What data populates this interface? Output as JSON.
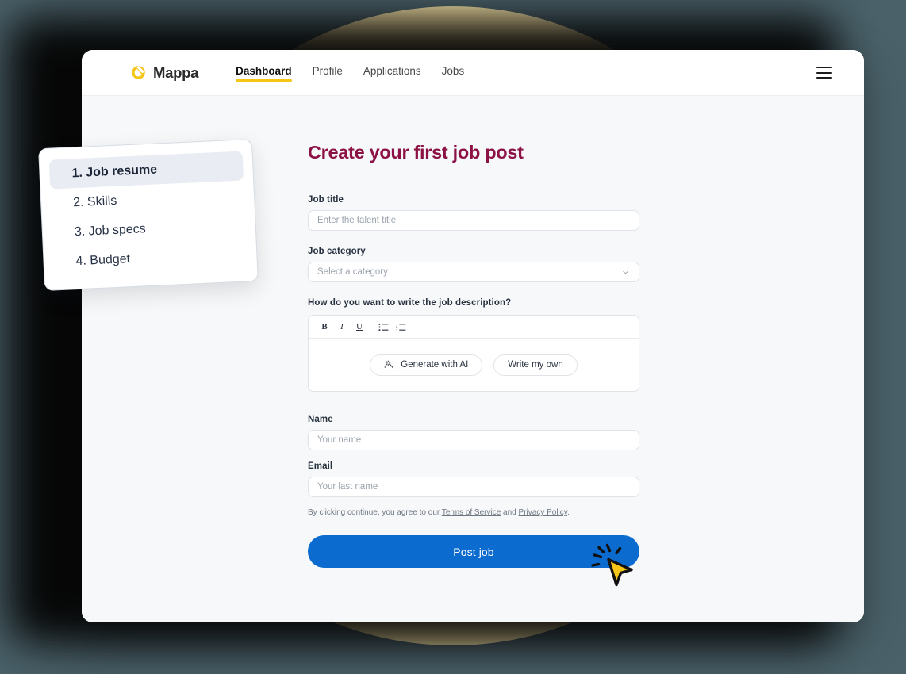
{
  "background": {
    "page_color": "#4a6169",
    "circle_color": "#f7e5a9"
  },
  "topbar": {
    "brand": {
      "logo_icon": "mappa-logo-icon",
      "name": "Mappa",
      "logo_color": "#f5c518"
    },
    "nav": [
      {
        "label": "Dashboard",
        "active": true
      },
      {
        "label": "Profile",
        "active": false
      },
      {
        "label": "Applications",
        "active": false
      },
      {
        "label": "Jobs",
        "active": false
      }
    ],
    "menu_icon": "hamburger-menu-icon",
    "active_underline_color": "#f5c518"
  },
  "steps_card": {
    "items": [
      {
        "label": "1. Job resume",
        "active": true
      },
      {
        "label": "2. Skills",
        "active": false
      },
      {
        "label": "3. Job specs",
        "active": false
      },
      {
        "label": "4. Budget",
        "active": false
      }
    ]
  },
  "form": {
    "title": "Create your first job post",
    "title_color": "#8c1246",
    "job_title": {
      "label": "Job title",
      "value": "",
      "placeholder": "Enter the talent title"
    },
    "job_category": {
      "label": "Job category",
      "selected": "Select a category",
      "chevron_icon": "chevron-down-icon"
    },
    "description": {
      "label": "How do you want to write the job description?",
      "toolbar": [
        {
          "name": "bold-icon",
          "glyph": "B"
        },
        {
          "name": "italic-icon",
          "glyph": "I"
        },
        {
          "name": "underline-icon",
          "glyph": "U"
        },
        {
          "name": "bullet-list-icon",
          "glyph": ""
        },
        {
          "name": "numbered-list-icon",
          "glyph": ""
        }
      ],
      "generate_button": {
        "label": "Generate with AI",
        "icon": "sparkle-wand-icon"
      },
      "write_button": {
        "label": "Write my own"
      }
    },
    "name": {
      "label": "Name",
      "value": "",
      "placeholder": "Your name"
    },
    "email": {
      "label": "Email",
      "value": "",
      "placeholder": "Your last name"
    },
    "terms": {
      "prefix": "By clicking continue, you agree to our ",
      "terms_link": "Terms of Service",
      "middle": " and ",
      "privacy_link": "Privacy Policy",
      "suffix": "."
    },
    "submit": {
      "label": "Post job",
      "color": "#0b6bce"
    }
  },
  "cursor": {
    "icon": "click-cursor-icon",
    "color": "#f5c518"
  }
}
